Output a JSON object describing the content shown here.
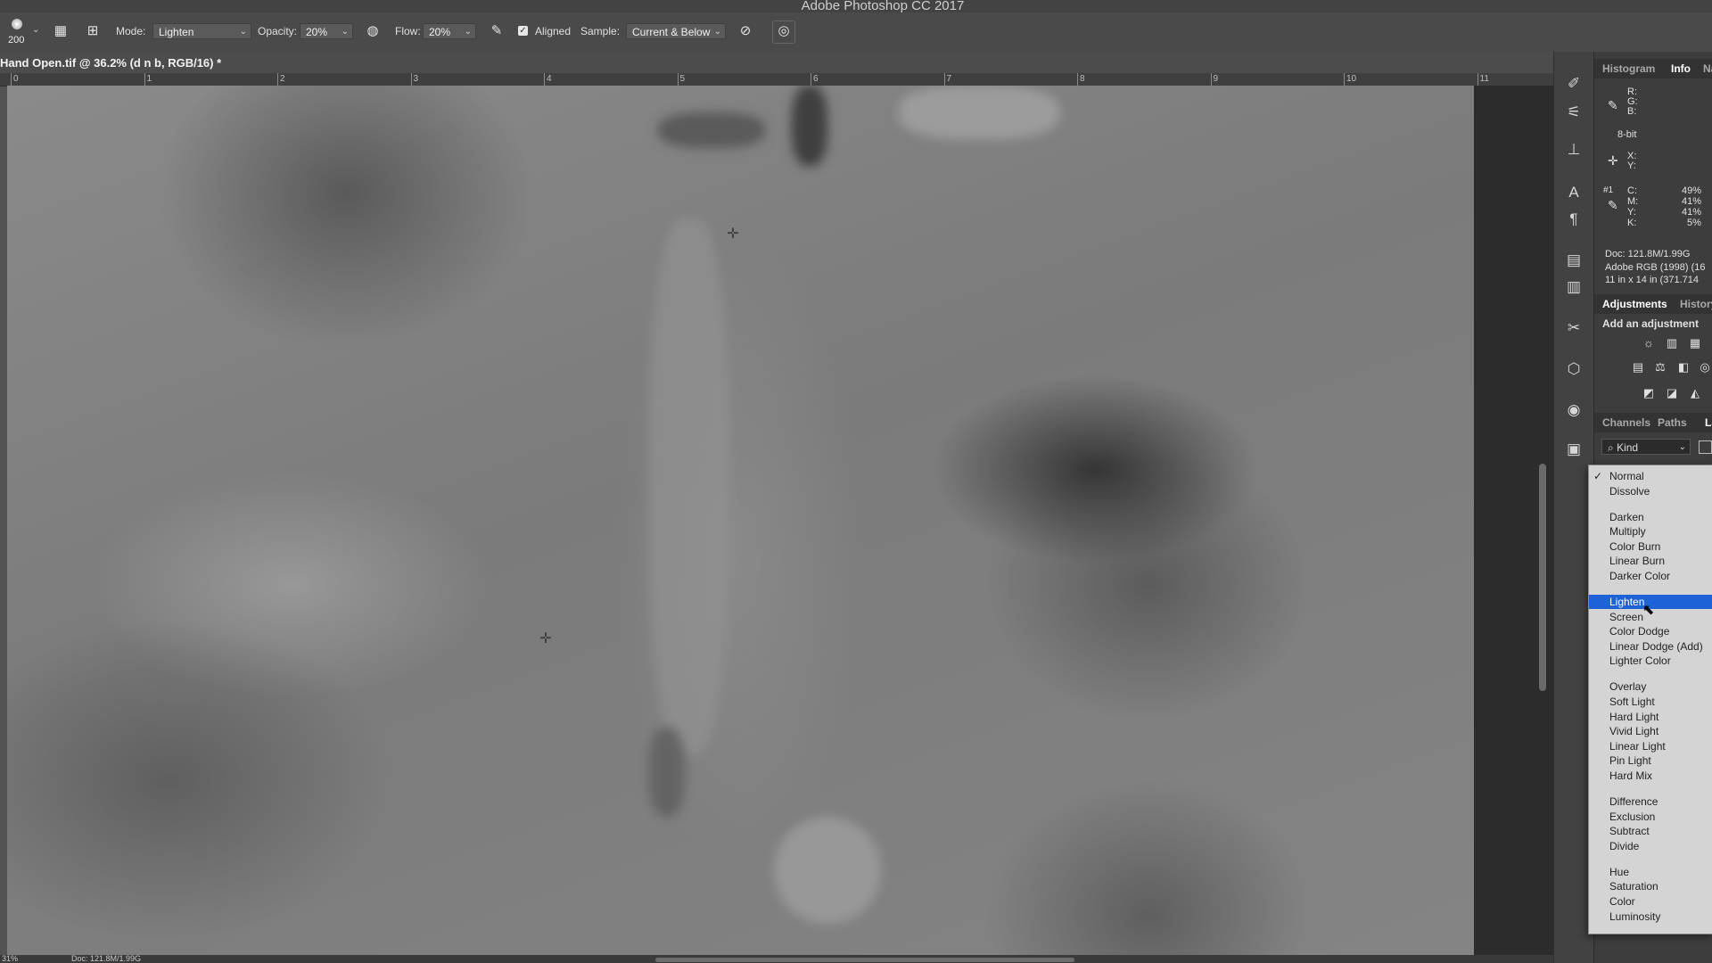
{
  "window": {
    "title": "Adobe Photoshop CC 2017"
  },
  "options_bar": {
    "brush_size": "200",
    "mode_label": "Mode:",
    "mode_value": "Lighten",
    "opacity_label": "Opacity:",
    "opacity_value": "20%",
    "flow_label": "Flow:",
    "flow_value": "20%",
    "aligned_label": "Aligned",
    "aligned_checked": true,
    "sample_label": "Sample:",
    "sample_value": "Current & Below"
  },
  "document": {
    "tab_title": "Hand Open.tif @ 36.2% (d n b, RGB/16) *",
    "ruler_ticks": [
      "0",
      "1",
      "2",
      "3",
      "4",
      "5",
      "6",
      "7",
      "8",
      "9",
      "10",
      "11"
    ]
  },
  "statusbar": {
    "zoom": "31%",
    "doc": "Doc: 121.8M/1.99G"
  },
  "panels": {
    "top_tabs": {
      "histogram": "Histogram",
      "info": "Info",
      "navigator": "Na"
    },
    "info": {
      "rgb_labels": "R:\nG:\nB:",
      "bit_depth": "8-bit",
      "xy_labels": "X:\nY:",
      "sample_number": "#1",
      "cmyk": [
        {
          "label": "C:",
          "value": "49%"
        },
        {
          "label": "M:",
          "value": "41%"
        },
        {
          "label": "Y:",
          "value": "41%"
        },
        {
          "label": "K:",
          "value": "5%"
        }
      ],
      "doc_size": "Doc: 121.8M/1.99G",
      "profile": "Adobe RGB (1998) (16",
      "dimensions": "11 in x 14 in (371.714"
    },
    "adjustments": {
      "tab_active": "Adjustments",
      "tab_inactive": "History",
      "add_label": "Add an adjustment"
    },
    "layers": {
      "tab_channels": "Channels",
      "tab_paths": "Paths",
      "tab_layers": "La",
      "filter_kind": "Kind"
    }
  },
  "blend_menu": {
    "selected": "Lighten",
    "items": [
      "Normal",
      "Dissolve",
      "Darken",
      "Multiply",
      "Color Burn",
      "Linear Burn",
      "Darker Color",
      "Lighten",
      "Screen",
      "Color Dodge",
      "Linear Dodge (Add)",
      "Lighter Color",
      "Overlay",
      "Soft Light",
      "Hard Light",
      "Vivid Light",
      "Linear Light",
      "Pin Light",
      "Hard Mix",
      "Difference",
      "Exclusion",
      "Subtract",
      "Divide",
      "Hue",
      "Saturation",
      "Color",
      "Luminosity"
    ]
  },
  "icons": {
    "brush": "brush-icon",
    "clone_source": "clone-source-icon",
    "stamp": "stamp-icon",
    "pressure_opacity": "pressure-opacity-icon",
    "airbrush": "airbrush-icon",
    "ignore_adjustment": "ignore-adjustment-layers-icon",
    "pressure_size": "pressure-size-icon",
    "eyedropper": "eyedropper-icon",
    "crosshair": "crosshair-icon"
  },
  "colors": {
    "selection": "#1d62d6",
    "panel_bg": "#3d3d3d",
    "menu_bg": "#d4d4d4"
  }
}
